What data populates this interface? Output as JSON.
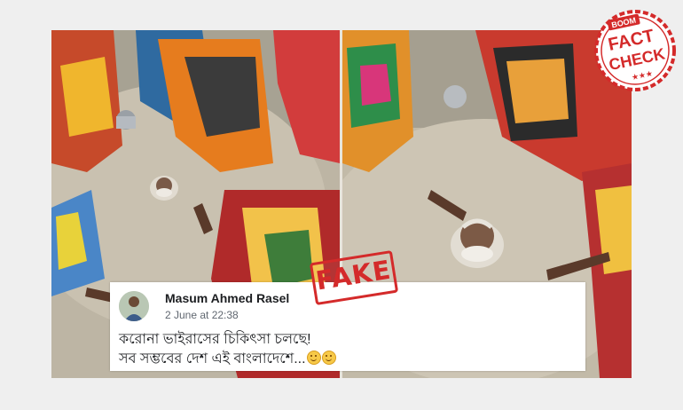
{
  "post": {
    "author": "Masum Ahmed Rasel",
    "date": "2 June at 22:38",
    "lines": [
      "করোনা ভাইরাসের চিকিৎসা চলছে!",
      "সব সম্ভবের দেশ এই বাংলাদেশে..."
    ],
    "emojis": [
      "slightly-smiling-face-icon",
      "slightly-smiling-face-icon"
    ]
  },
  "stamp": {
    "label": "FAKE",
    "color": "#d42a2a"
  },
  "badge": {
    "brand": "BOOM",
    "line1": "FACT",
    "line2": "CHECK",
    "stars": "★★★",
    "color": "#d42a2a"
  },
  "colors": {
    "page_background": "#efefef",
    "card_background": "#ffffff"
  }
}
